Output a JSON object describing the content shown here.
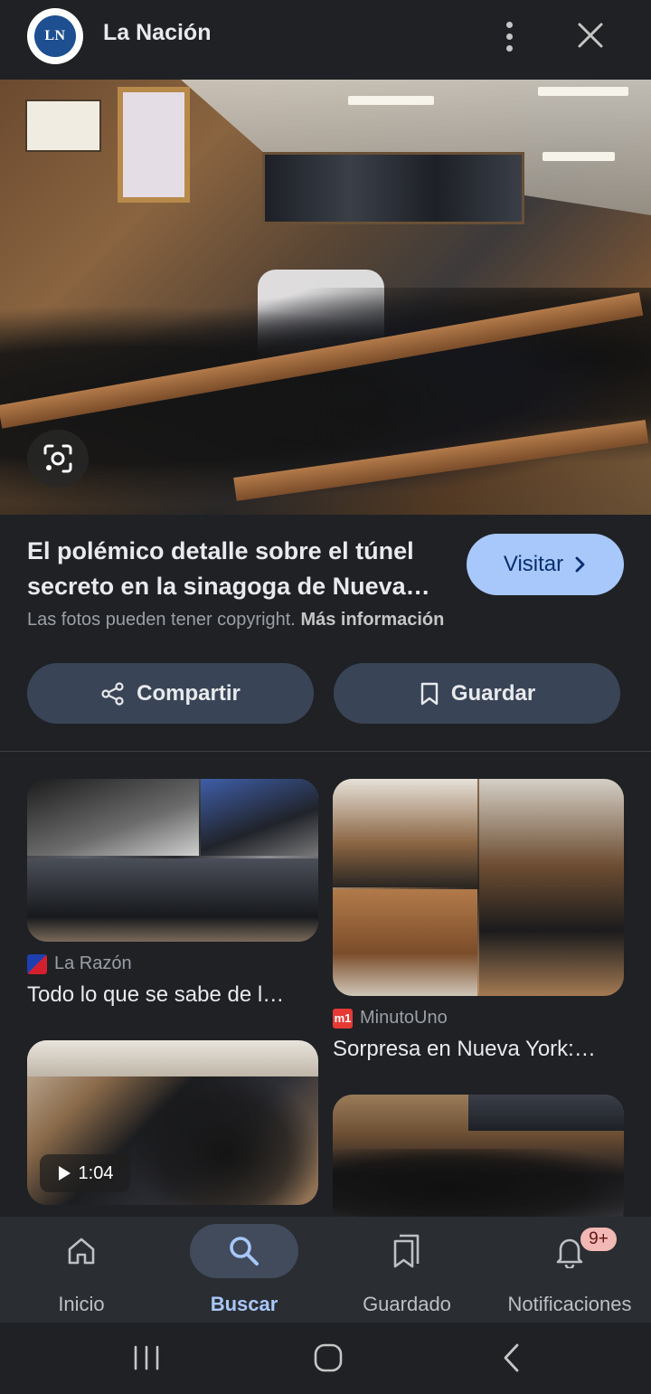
{
  "header": {
    "logo_text": "LN",
    "site_name": "La Nación",
    "more_icon": "more-vert-icon",
    "close_icon": "close-icon"
  },
  "hero": {
    "lens_icon": "google-lens-icon"
  },
  "info": {
    "title": "El polémico detalle sobre el túnel secreto en la sinagoga de Nueva…",
    "visit_label": "Visitar",
    "copyright_text": "Las fotos pueden tener copyright.",
    "more_info_label": "Más información",
    "share_label": "Compartir",
    "save_label": "Guardar",
    "accent_color": "#a8c7fa"
  },
  "results": [
    {
      "source": "La Razón",
      "title": "Todo lo que se sabe de l…",
      "favicon_color": "#d3202e"
    },
    {
      "source": "MinutoUno",
      "title": "Sorpresa en Nueva York:…",
      "favicon_color": "#e53935",
      "favicon_text": "m1"
    },
    {
      "duration": "1:04"
    },
    {}
  ],
  "bottom_nav": {
    "items": [
      {
        "label": "Inicio",
        "icon": "home-icon"
      },
      {
        "label": "Buscar",
        "icon": "search-icon",
        "active": true
      },
      {
        "label": "Guardado",
        "icon": "bookmarks-icon"
      },
      {
        "label": "Notificaciones",
        "icon": "bell-icon",
        "badge": "9+"
      }
    ]
  },
  "system_nav": {
    "recents_icon": "recents-icon",
    "home_icon": "home-circle-icon",
    "back_icon": "back-icon"
  }
}
